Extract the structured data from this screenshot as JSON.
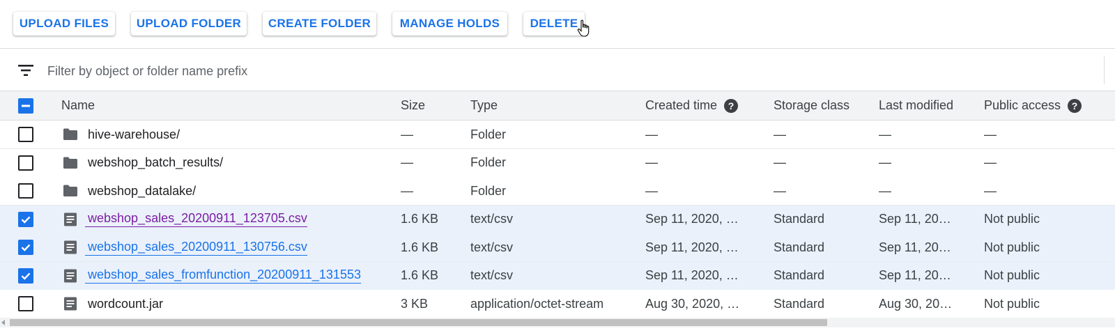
{
  "toolbar": {
    "buttons": [
      {
        "label": "UPLOAD FILES"
      },
      {
        "label": "UPLOAD FOLDER"
      },
      {
        "label": "CREATE FOLDER"
      },
      {
        "label": "MANAGE HOLDS"
      },
      {
        "label": "DELETE"
      }
    ]
  },
  "filter": {
    "placeholder": "Filter by object or folder name prefix",
    "icon": "filter-list-icon"
  },
  "table": {
    "select_all": "indeterminate",
    "headers": {
      "name": "Name",
      "size": "Size",
      "type": "Type",
      "created": "Created time",
      "storage": "Storage class",
      "modified": "Last modified",
      "public": "Public access"
    },
    "rows": [
      {
        "checked": false,
        "icon": "folder-icon",
        "name": "hive-warehouse/",
        "size": "—",
        "type": "Folder",
        "created": "—",
        "storage": "—",
        "modified": "—",
        "public": "—"
      },
      {
        "checked": false,
        "icon": "folder-icon",
        "name": "webshop_batch_results/",
        "size": "—",
        "type": "Folder",
        "created": "—",
        "storage": "—",
        "modified": "—",
        "public": "—"
      },
      {
        "checked": false,
        "icon": "folder-icon",
        "name": "webshop_datalake/",
        "size": "—",
        "type": "Folder",
        "created": "—",
        "storage": "—",
        "modified": "—",
        "public": "—"
      },
      {
        "checked": true,
        "icon": "file-icon",
        "name": "webshop_sales_20200911_123705.csv",
        "size": "1.6 KB",
        "type": "text/csv",
        "created": "Sep 11, 2020, …",
        "storage": "Standard",
        "modified": "Sep 11, 20…",
        "public": "Not public"
      },
      {
        "checked": true,
        "icon": "file-icon",
        "name": "webshop_sales_20200911_130756.csv",
        "size": "1.6 KB",
        "type": "text/csv",
        "created": "Sep 11, 2020, …",
        "storage": "Standard",
        "modified": "Sep 11, 20…",
        "public": "Not public"
      },
      {
        "checked": true,
        "icon": "file-icon",
        "name": "webshop_sales_fromfunction_20200911_131553",
        "size": "1.6 KB",
        "type": "text/csv",
        "created": "Sep 11, 2020, …",
        "storage": "Standard",
        "modified": "Sep 11, 20…",
        "public": "Not public"
      },
      {
        "checked": false,
        "icon": "file-icon",
        "name": "wordcount.jar",
        "size": "3 KB",
        "type": "application/octet-stream",
        "created": "Aug 30, 2020, …",
        "storage": "Standard",
        "modified": "Aug 30, 20…",
        "public": "Not public"
      }
    ]
  },
  "colors": {
    "accent": "#1a73e8",
    "visited_link": "#7b1fa2",
    "selected_row": "#eaf1fb",
    "header_bg": "#f1f3f4"
  }
}
